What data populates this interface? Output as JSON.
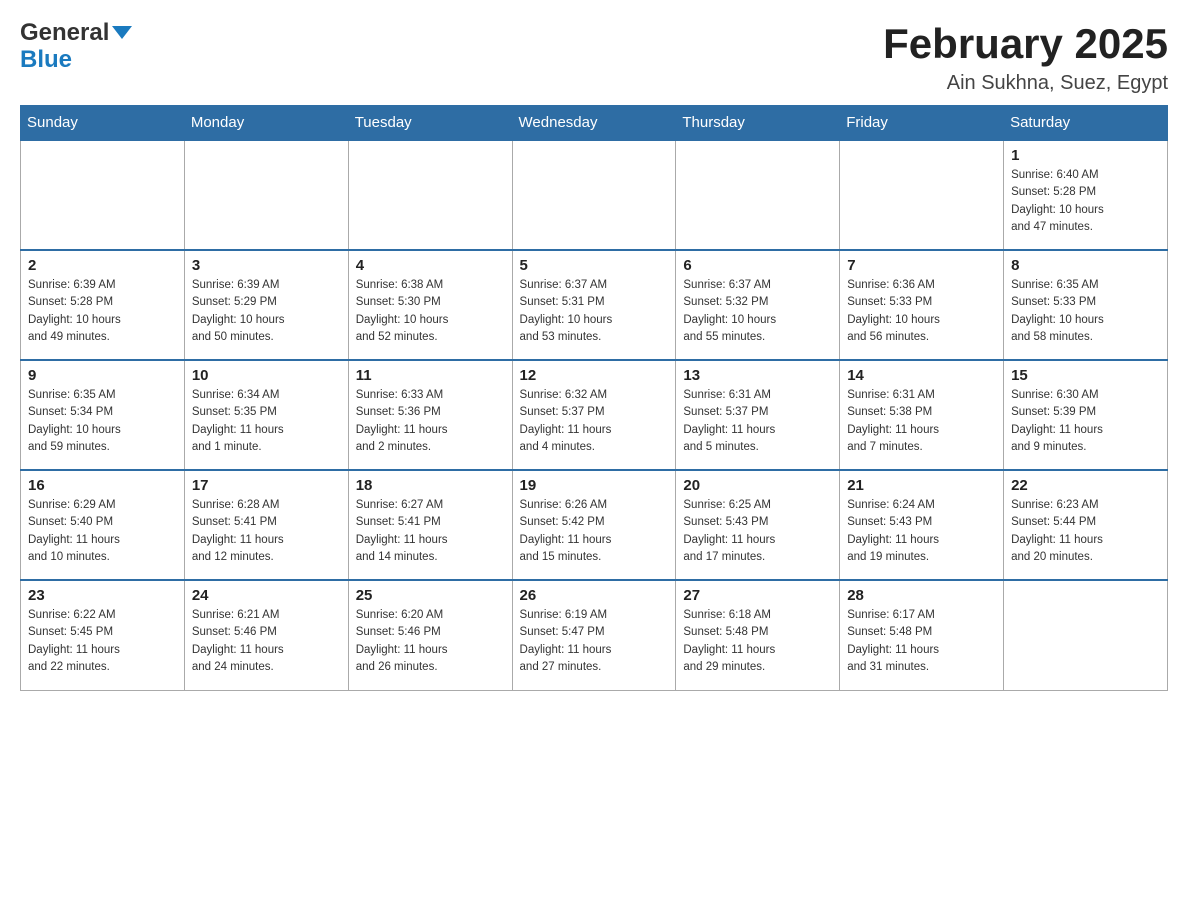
{
  "logo": {
    "text_general": "General",
    "text_blue": "Blue"
  },
  "title": "February 2025",
  "subtitle": "Ain Sukhna, Suez, Egypt",
  "weekdays": [
    "Sunday",
    "Monday",
    "Tuesday",
    "Wednesday",
    "Thursday",
    "Friday",
    "Saturday"
  ],
  "weeks": [
    [
      {
        "day": "",
        "info": ""
      },
      {
        "day": "",
        "info": ""
      },
      {
        "day": "",
        "info": ""
      },
      {
        "day": "",
        "info": ""
      },
      {
        "day": "",
        "info": ""
      },
      {
        "day": "",
        "info": ""
      },
      {
        "day": "1",
        "info": "Sunrise: 6:40 AM\nSunset: 5:28 PM\nDaylight: 10 hours\nand 47 minutes."
      }
    ],
    [
      {
        "day": "2",
        "info": "Sunrise: 6:39 AM\nSunset: 5:28 PM\nDaylight: 10 hours\nand 49 minutes."
      },
      {
        "day": "3",
        "info": "Sunrise: 6:39 AM\nSunset: 5:29 PM\nDaylight: 10 hours\nand 50 minutes."
      },
      {
        "day": "4",
        "info": "Sunrise: 6:38 AM\nSunset: 5:30 PM\nDaylight: 10 hours\nand 52 minutes."
      },
      {
        "day": "5",
        "info": "Sunrise: 6:37 AM\nSunset: 5:31 PM\nDaylight: 10 hours\nand 53 minutes."
      },
      {
        "day": "6",
        "info": "Sunrise: 6:37 AM\nSunset: 5:32 PM\nDaylight: 10 hours\nand 55 minutes."
      },
      {
        "day": "7",
        "info": "Sunrise: 6:36 AM\nSunset: 5:33 PM\nDaylight: 10 hours\nand 56 minutes."
      },
      {
        "day": "8",
        "info": "Sunrise: 6:35 AM\nSunset: 5:33 PM\nDaylight: 10 hours\nand 58 minutes."
      }
    ],
    [
      {
        "day": "9",
        "info": "Sunrise: 6:35 AM\nSunset: 5:34 PM\nDaylight: 10 hours\nand 59 minutes."
      },
      {
        "day": "10",
        "info": "Sunrise: 6:34 AM\nSunset: 5:35 PM\nDaylight: 11 hours\nand 1 minute."
      },
      {
        "day": "11",
        "info": "Sunrise: 6:33 AM\nSunset: 5:36 PM\nDaylight: 11 hours\nand 2 minutes."
      },
      {
        "day": "12",
        "info": "Sunrise: 6:32 AM\nSunset: 5:37 PM\nDaylight: 11 hours\nand 4 minutes."
      },
      {
        "day": "13",
        "info": "Sunrise: 6:31 AM\nSunset: 5:37 PM\nDaylight: 11 hours\nand 5 minutes."
      },
      {
        "day": "14",
        "info": "Sunrise: 6:31 AM\nSunset: 5:38 PM\nDaylight: 11 hours\nand 7 minutes."
      },
      {
        "day": "15",
        "info": "Sunrise: 6:30 AM\nSunset: 5:39 PM\nDaylight: 11 hours\nand 9 minutes."
      }
    ],
    [
      {
        "day": "16",
        "info": "Sunrise: 6:29 AM\nSunset: 5:40 PM\nDaylight: 11 hours\nand 10 minutes."
      },
      {
        "day": "17",
        "info": "Sunrise: 6:28 AM\nSunset: 5:41 PM\nDaylight: 11 hours\nand 12 minutes."
      },
      {
        "day": "18",
        "info": "Sunrise: 6:27 AM\nSunset: 5:41 PM\nDaylight: 11 hours\nand 14 minutes."
      },
      {
        "day": "19",
        "info": "Sunrise: 6:26 AM\nSunset: 5:42 PM\nDaylight: 11 hours\nand 15 minutes."
      },
      {
        "day": "20",
        "info": "Sunrise: 6:25 AM\nSunset: 5:43 PM\nDaylight: 11 hours\nand 17 minutes."
      },
      {
        "day": "21",
        "info": "Sunrise: 6:24 AM\nSunset: 5:43 PM\nDaylight: 11 hours\nand 19 minutes."
      },
      {
        "day": "22",
        "info": "Sunrise: 6:23 AM\nSunset: 5:44 PM\nDaylight: 11 hours\nand 20 minutes."
      }
    ],
    [
      {
        "day": "23",
        "info": "Sunrise: 6:22 AM\nSunset: 5:45 PM\nDaylight: 11 hours\nand 22 minutes."
      },
      {
        "day": "24",
        "info": "Sunrise: 6:21 AM\nSunset: 5:46 PM\nDaylight: 11 hours\nand 24 minutes."
      },
      {
        "day": "25",
        "info": "Sunrise: 6:20 AM\nSunset: 5:46 PM\nDaylight: 11 hours\nand 26 minutes."
      },
      {
        "day": "26",
        "info": "Sunrise: 6:19 AM\nSunset: 5:47 PM\nDaylight: 11 hours\nand 27 minutes."
      },
      {
        "day": "27",
        "info": "Sunrise: 6:18 AM\nSunset: 5:48 PM\nDaylight: 11 hours\nand 29 minutes."
      },
      {
        "day": "28",
        "info": "Sunrise: 6:17 AM\nSunset: 5:48 PM\nDaylight: 11 hours\nand 31 minutes."
      },
      {
        "day": "",
        "info": ""
      }
    ]
  ]
}
